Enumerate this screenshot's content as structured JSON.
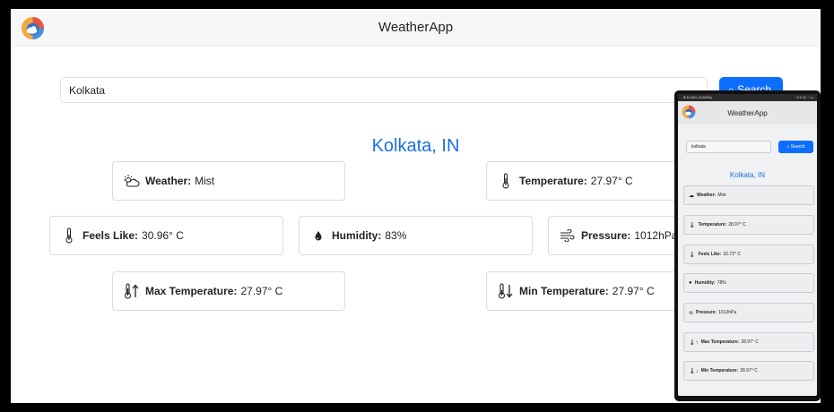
{
  "app": {
    "title": "WeatherApp"
  },
  "search": {
    "value": "Kolkata",
    "button_label": "Search"
  },
  "location": "Kolkata, IN",
  "cards": {
    "weather": {
      "label": "Weather:",
      "value": "Mist",
      "icon": "cloud-sun-icon"
    },
    "temperature": {
      "label": "Temperature:",
      "value": "27.97° C",
      "icon": "thermometer-icon"
    },
    "feels_like": {
      "label": "Feels Like:",
      "value": "30.96° C",
      "icon": "thermometer-icon"
    },
    "humidity": {
      "label": "Humidity:",
      "value": "83%",
      "icon": "droplet-icon"
    },
    "pressure": {
      "label": "Pressure:",
      "value": "1012hPa",
      "icon": "wind-icon"
    },
    "max_temp": {
      "label": "Max Temperature:",
      "value": "27.97° C",
      "icon": "thermometer-up-icon"
    },
    "min_temp": {
      "label": "Min Temperature:",
      "value": "27.97° C",
      "icon": "thermometer-down-icon"
    }
  },
  "phone": {
    "status_time": "8:14 AM | 6.8KB/s",
    "status_icons": "⁖ıl ıl ⊜ ⁖ ▭",
    "app_title": "WeatherApp",
    "search_value": "kolkata",
    "search_button": "Search",
    "location": "Kolkata, IN",
    "cards": [
      {
        "label": "Weather:",
        "value": "Mist"
      },
      {
        "label": "Temperature:",
        "value": "28.97° C"
      },
      {
        "label": "Feels Like:",
        "value": "32.72° C"
      },
      {
        "label": "Humidity:",
        "value": "78%"
      },
      {
        "label": "Pressure:",
        "value": "1012hPa"
      },
      {
        "label": "Max Temperature:",
        "value": "28.97° C"
      },
      {
        "label": "Min Temperature:",
        "value": "28.97° C"
      }
    ]
  },
  "colors": {
    "accent": "#0d6efd",
    "city": "#1a6fe6",
    "topbar": "#f6f7f8"
  }
}
